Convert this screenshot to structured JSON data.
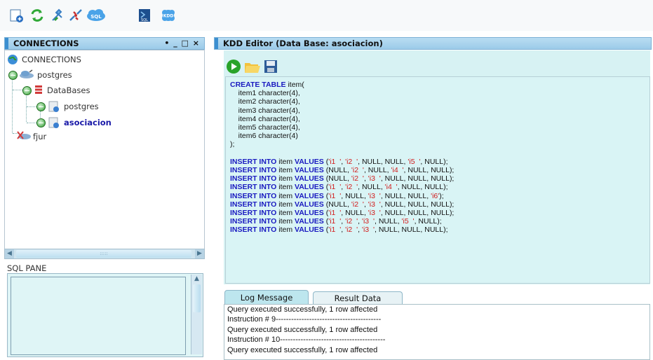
{
  "toolbar": {
    "icons": [
      "new-connection-icon",
      "refresh-icon",
      "connect-icon",
      "disconnect-icon",
      "sql-cloud-icon",
      "sql-file-icon",
      "kdd-icon"
    ],
    "sql_badge": "SQL",
    "kdd_badge": "KDD"
  },
  "connections_panel": {
    "title": "CONNECTIONS",
    "controls": "• _ □ ×",
    "tree": {
      "root": "CONNECTIONS",
      "postgres": "postgres",
      "databases": "DataBases",
      "db_postgres": "postgres",
      "db_asociacion": "asociacion",
      "fjur": "fjur"
    }
  },
  "sql_pane": {
    "label": "SQL PANE"
  },
  "editor": {
    "title": "KDD Editor (Data Base: asociacion)",
    "create_kw": "CREATE TABLE",
    "create_rest": " item(",
    "columns": [
      "item1 character(4),",
      "item2 character(4),",
      "item3 character(4),",
      "item4 character(4),",
      "item5 character(4),",
      "item6 character(4)"
    ],
    "close_paren": ");",
    "inserts": [
      [
        "'i1  '",
        "'i2  '",
        "NULL",
        "NULL",
        "'i5  '",
        "NULL"
      ],
      [
        "NULL",
        "'i2  '",
        "NULL",
        "'i4  '",
        "NULL",
        "NULL"
      ],
      [
        "NULL",
        "'i2  '",
        "'i3  '",
        "NULL",
        "NULL",
        "NULL"
      ],
      [
        "'i1  '",
        "'i2  '",
        "NULL",
        "'i4  '",
        "NULL",
        "NULL"
      ],
      [
        "'i1  '",
        "NULL",
        "'i3  '",
        "NULL",
        "NULL",
        "'i6'"
      ],
      [
        "NULL",
        "'i2  '",
        "'i3  '",
        "NULL",
        "NULL",
        "NULL"
      ],
      [
        "'i1  '",
        "NULL",
        "'i3  '",
        "NULL",
        "NULL",
        "NULL"
      ],
      [
        "'i1  '",
        "'i2  '",
        "'i3  '",
        "NULL",
        "'i5  '",
        "NULL"
      ],
      [
        "'i1  '",
        "'i2  '",
        "'i3  '",
        "NULL",
        "NULL",
        "NULL"
      ]
    ],
    "insert_kw": "INSERT INTO",
    "table_name": " item ",
    "values_kw": "VALUES"
  },
  "bottom": {
    "tabs": [
      "Log Message",
      "Result Data"
    ],
    "log_lines": [
      "Query executed successfully, 1 row affected",
      "Instruction # 9-----------------------------------------",
      "Query executed successfully, 1 row affected",
      "Instruction # 10-----------------------------------------",
      "Query executed successfully, 1 row affected"
    ]
  }
}
